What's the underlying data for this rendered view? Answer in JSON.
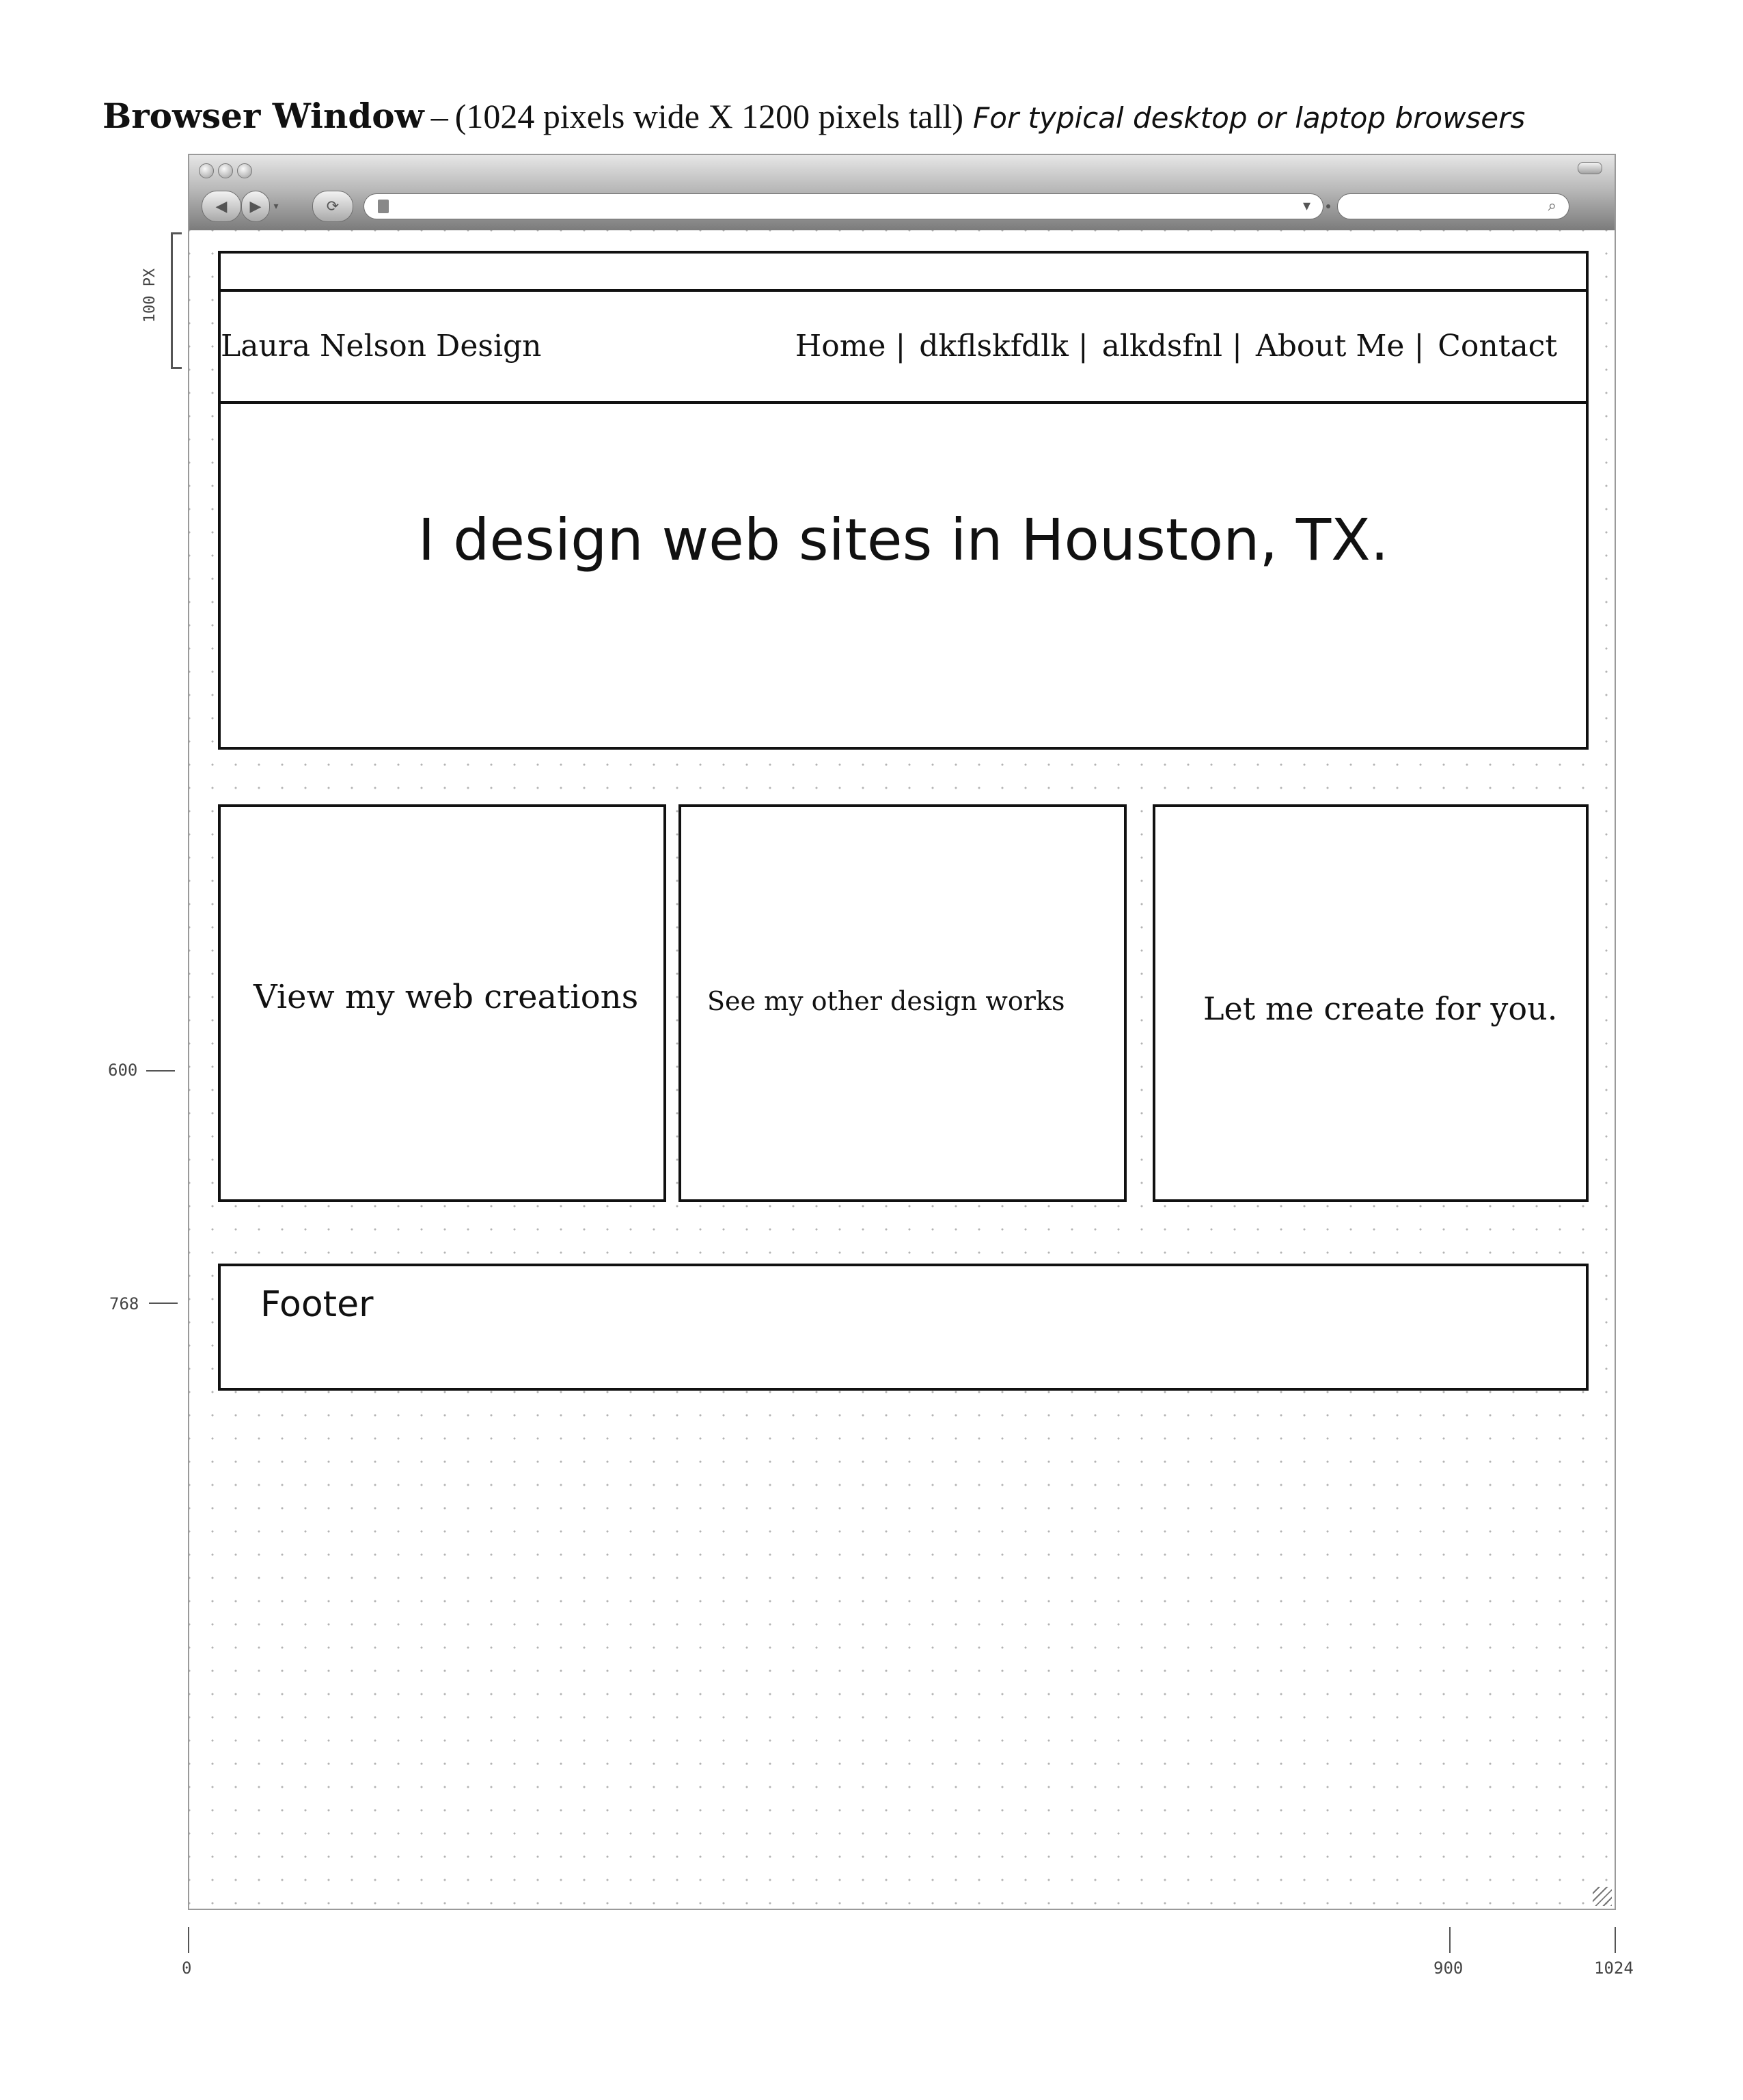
{
  "heading": {
    "bold": "Browser Window",
    "dash": "–",
    "dims": "(1024 pixels wide X 1200 pixels tall)",
    "note": "For typical desktop or laptop browsers"
  },
  "header": {
    "logo": "Laura Nelson Design",
    "nav": [
      "Home |",
      "dkflskfdlk |",
      "alkdsfnl |",
      "About Me |",
      "Contact"
    ]
  },
  "hero": {
    "headline": "I design web sites in Houston, TX."
  },
  "cards": [
    {
      "label": "View my web creations"
    },
    {
      "label": "See my other design works"
    },
    {
      "label": "Let me create for you."
    }
  ],
  "footer": {
    "label": "Footer"
  },
  "rulers": {
    "vertical": {
      "bracket_label": "100 PX",
      "marks": [
        "600",
        "768"
      ]
    },
    "horizontal": {
      "marks": [
        "0",
        "900",
        "1024"
      ]
    }
  }
}
